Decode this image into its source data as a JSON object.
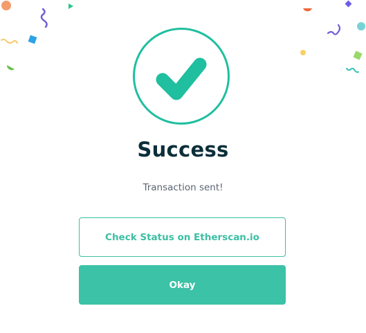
{
  "dialog": {
    "title": "Success",
    "message": "Transaction sent!",
    "secondary_button_label": "Check Status on Etherscan.io",
    "primary_button_label": "Okay"
  },
  "icons": {
    "status": "checkmark-icon"
  },
  "colors": {
    "accent": "#3cc2a6",
    "title": "#0b2f3a",
    "message": "#5a6472",
    "background": "#ffffff"
  }
}
